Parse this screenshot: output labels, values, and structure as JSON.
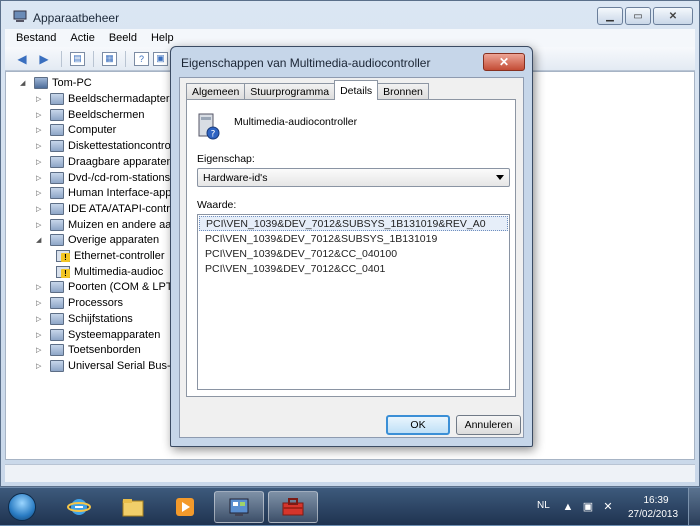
{
  "main_window": {
    "title": "Apparaatbeheer",
    "menu": [
      "Bestand",
      "Actie",
      "Beeld",
      "Help"
    ],
    "tree": {
      "root": "Tom-PC",
      "items": [
        {
          "label": "Beeldschermadapters",
          "expanded": false
        },
        {
          "label": "Beeldschermen",
          "expanded": false
        },
        {
          "label": "Computer",
          "expanded": false
        },
        {
          "label": "Diskettestationcontroll",
          "expanded": false
        },
        {
          "label": "Draagbare apparaten",
          "expanded": false
        },
        {
          "label": "Dvd-/cd-rom-stations",
          "expanded": false
        },
        {
          "label": "Human Interface-appa",
          "expanded": false
        },
        {
          "label": "IDE ATA/ATAPI-contro",
          "expanded": false
        },
        {
          "label": "Muizen en andere aan",
          "expanded": false
        },
        {
          "label": "Overige apparaten",
          "expanded": true
        },
        {
          "label": "Ethernet-controller",
          "child": true,
          "warning": true
        },
        {
          "label": "Multimedia-audioc",
          "child": true,
          "warning": true
        },
        {
          "label": "Poorten (COM & LPT)",
          "expanded": false
        },
        {
          "label": "Processors",
          "expanded": false
        },
        {
          "label": "Schijfstations",
          "expanded": false
        },
        {
          "label": "Systeemapparaten",
          "expanded": false
        },
        {
          "label": "Toetsenborden",
          "expanded": false
        },
        {
          "label": "Universal Serial Bus-co",
          "expanded": false
        }
      ]
    }
  },
  "dialog": {
    "title": "Eigenschappen van Multimedia-audiocontroller",
    "close_label": "✕",
    "tabs": [
      "Algemeen",
      "Stuurprogramma",
      "Details",
      "Bronnen"
    ],
    "active_tab": "Details",
    "device_name": "Multimedia-audiocontroller",
    "property_label": "Eigenschap:",
    "property_value": "Hardware-id's",
    "value_label": "Waarde:",
    "values": [
      "PCI\\VEN_1039&DEV_7012&SUBSYS_1B131019&REV_A0",
      "PCI\\VEN_1039&DEV_7012&SUBSYS_1B131019",
      "PCI\\VEN_1039&DEV_7012&CC_040100",
      "PCI\\VEN_1039&DEV_7012&CC_0401"
    ],
    "ok_label": "OK",
    "cancel_label": "Annuleren"
  },
  "taskbar": {
    "language": "NL",
    "time": "16:39",
    "date": "27/02/2013"
  }
}
